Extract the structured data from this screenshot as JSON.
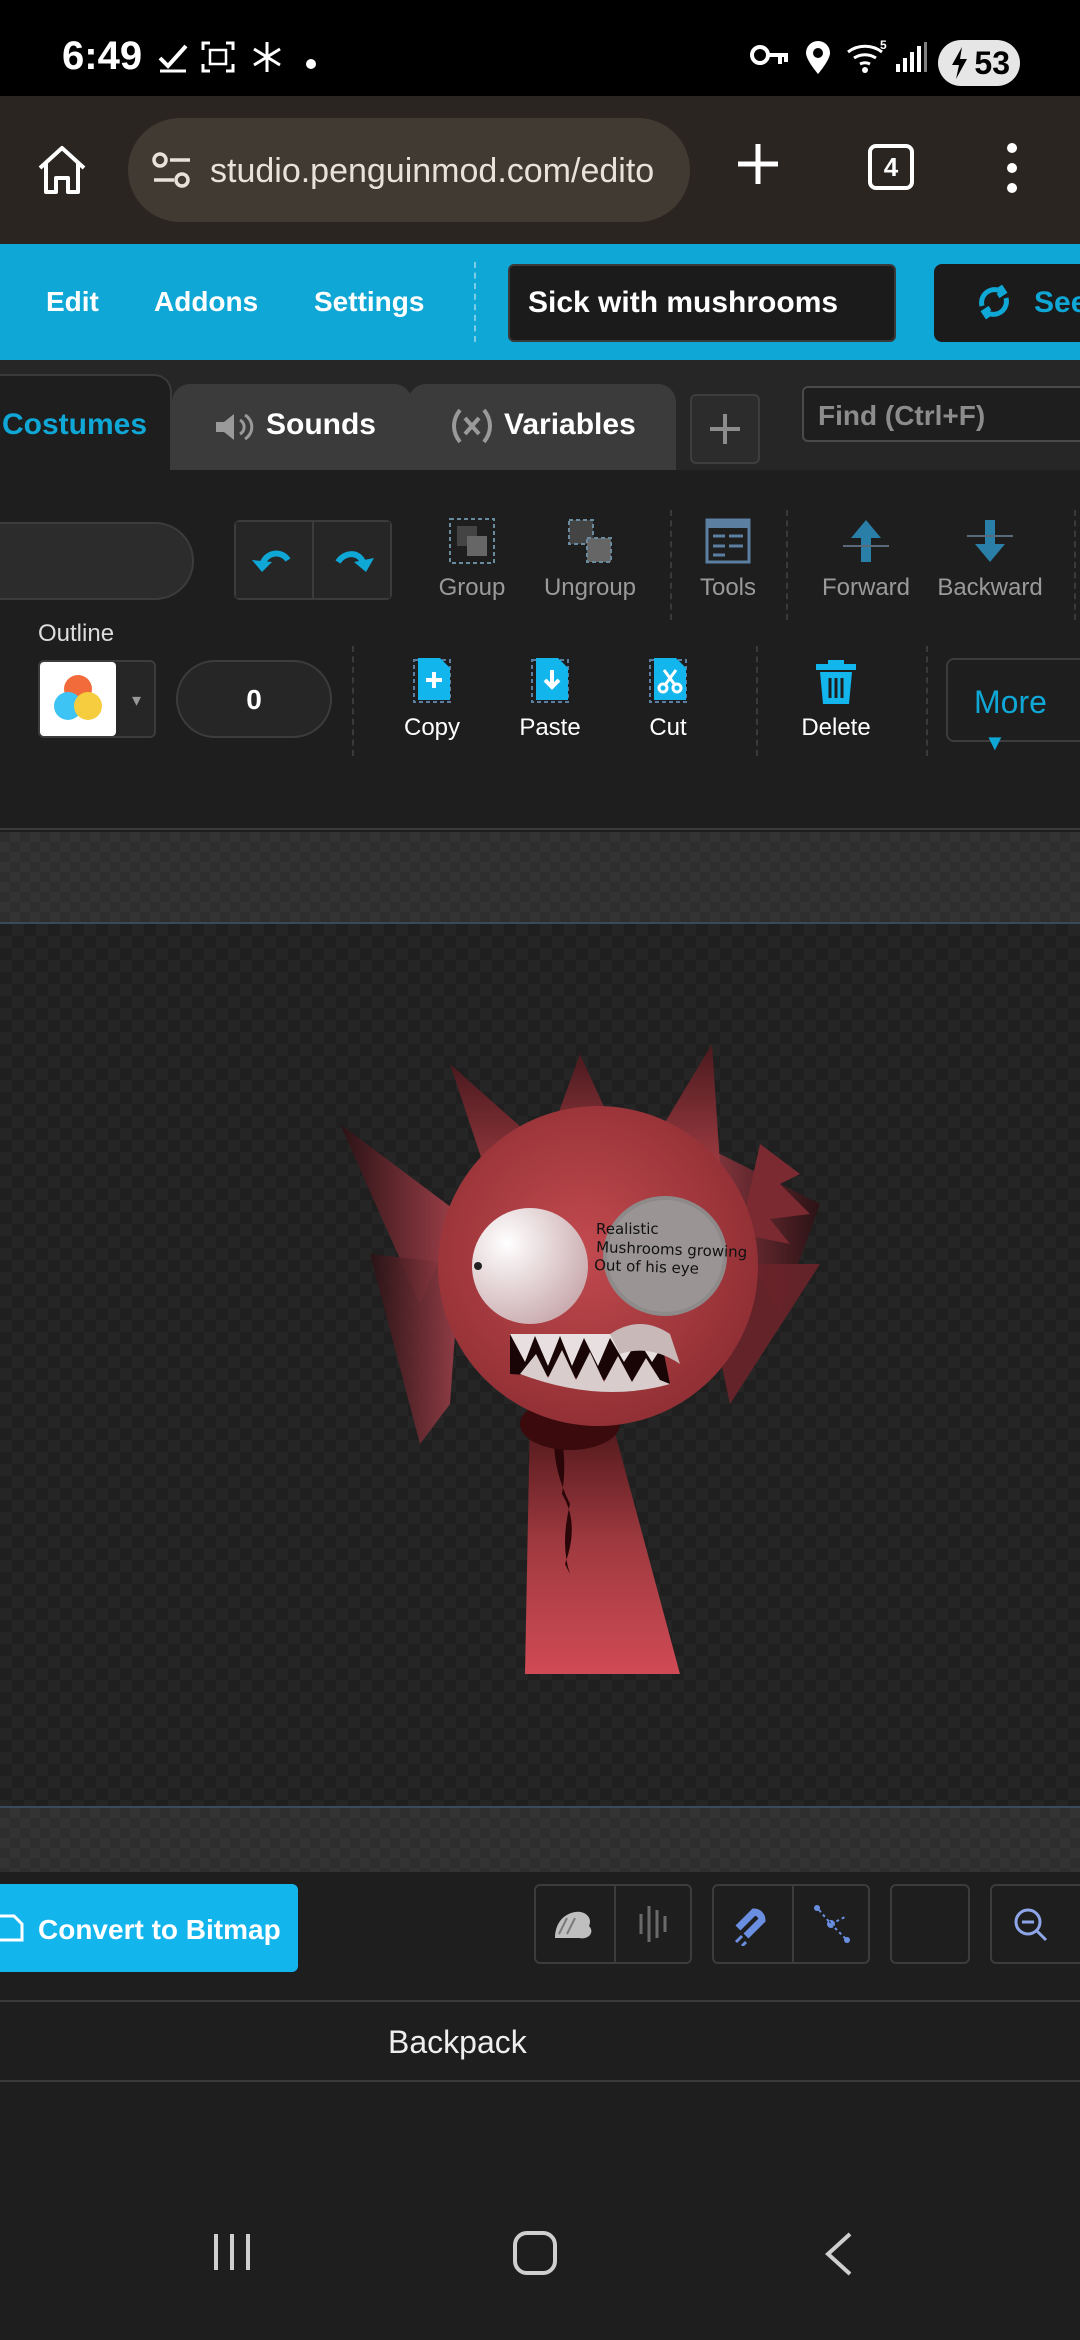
{
  "status_bar": {
    "time": "6:49",
    "battery": "53",
    "network": "5"
  },
  "browser": {
    "url": "studio.penguinmod.com/edito",
    "tab_count": "4"
  },
  "menu": {
    "edit": "Edit",
    "addons": "Addons",
    "settings": "Settings",
    "project_title": "Sick with mushrooms",
    "see_inside": "See"
  },
  "tabs": {
    "costumes": "Costumes",
    "sounds": "Sounds",
    "variables": "Variables",
    "find_placeholder": "Find (Ctrl+F)"
  },
  "toolbar": {
    "group": "Group",
    "ungroup": "Ungroup",
    "tools": "Tools",
    "forward": "Forward",
    "backward": "Backward",
    "outline_label": "Outline",
    "outline_width": "0",
    "copy": "Copy",
    "paste": "Paste",
    "cut": "Cut",
    "delete": "Delete",
    "more": "More"
  },
  "canvas": {
    "annotation": [
      "Realistic",
      "Mushrooms growing",
      "Out of his eye"
    ]
  },
  "bottom": {
    "convert": "Convert to Bitmap",
    "backpack": "Backpack"
  },
  "colors": {
    "accent": "#0fa7d6",
    "convert_button": "#12b5ec",
    "background": "#1e1e1e"
  },
  "icons": [
    "home-icon",
    "tune-icon",
    "plus-icon",
    "dots-vertical-icon",
    "speaker-icon",
    "variable-icon",
    "undo-icon",
    "redo-icon",
    "group-icon",
    "ungroup-icon",
    "tools-icon",
    "forward-arrow-icon",
    "backward-arrow-icon",
    "copy-icon",
    "paste-icon",
    "cut-icon",
    "trash-icon",
    "chevron-down-icon",
    "magnet-icon",
    "moon-icon",
    "zoom-out-icon"
  ]
}
